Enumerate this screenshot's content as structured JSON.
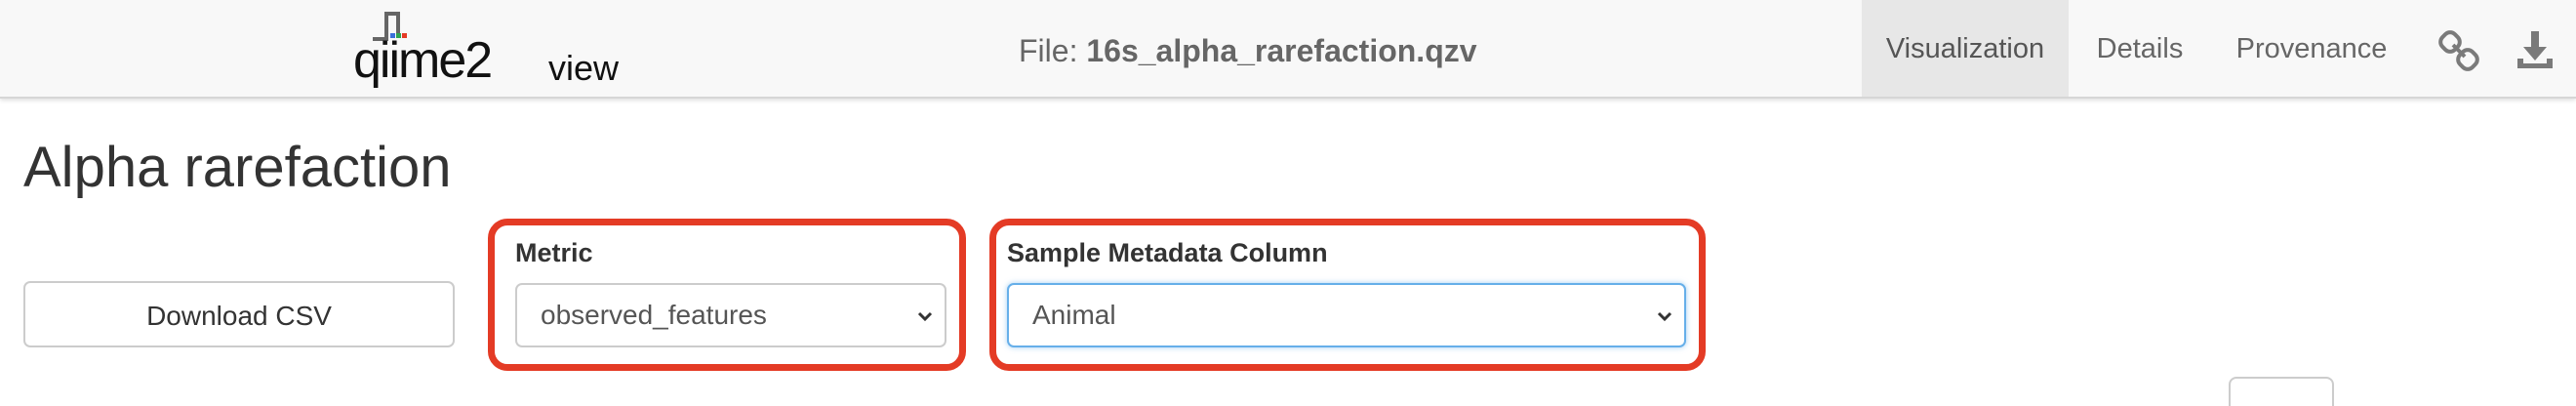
{
  "header": {
    "logo_text": "qiime2",
    "logo_suffix": "view",
    "file_prefix": "File: ",
    "file_name": "16s_alpha_rarefaction.qzv",
    "tabs": [
      {
        "label": "Visualization",
        "active": true
      },
      {
        "label": "Details",
        "active": false
      },
      {
        "label": "Provenance",
        "active": false
      }
    ],
    "icons": [
      "link-icon",
      "download-icon"
    ]
  },
  "main": {
    "title": "Alpha rarefaction",
    "download_button": "Download CSV",
    "metric": {
      "label": "Metric",
      "value": "observed_features"
    },
    "metadata_column": {
      "label": "Sample Metadata Column",
      "value": "Animal"
    }
  },
  "colors": {
    "highlight": "#e43b25",
    "focus": "#66afe9"
  }
}
